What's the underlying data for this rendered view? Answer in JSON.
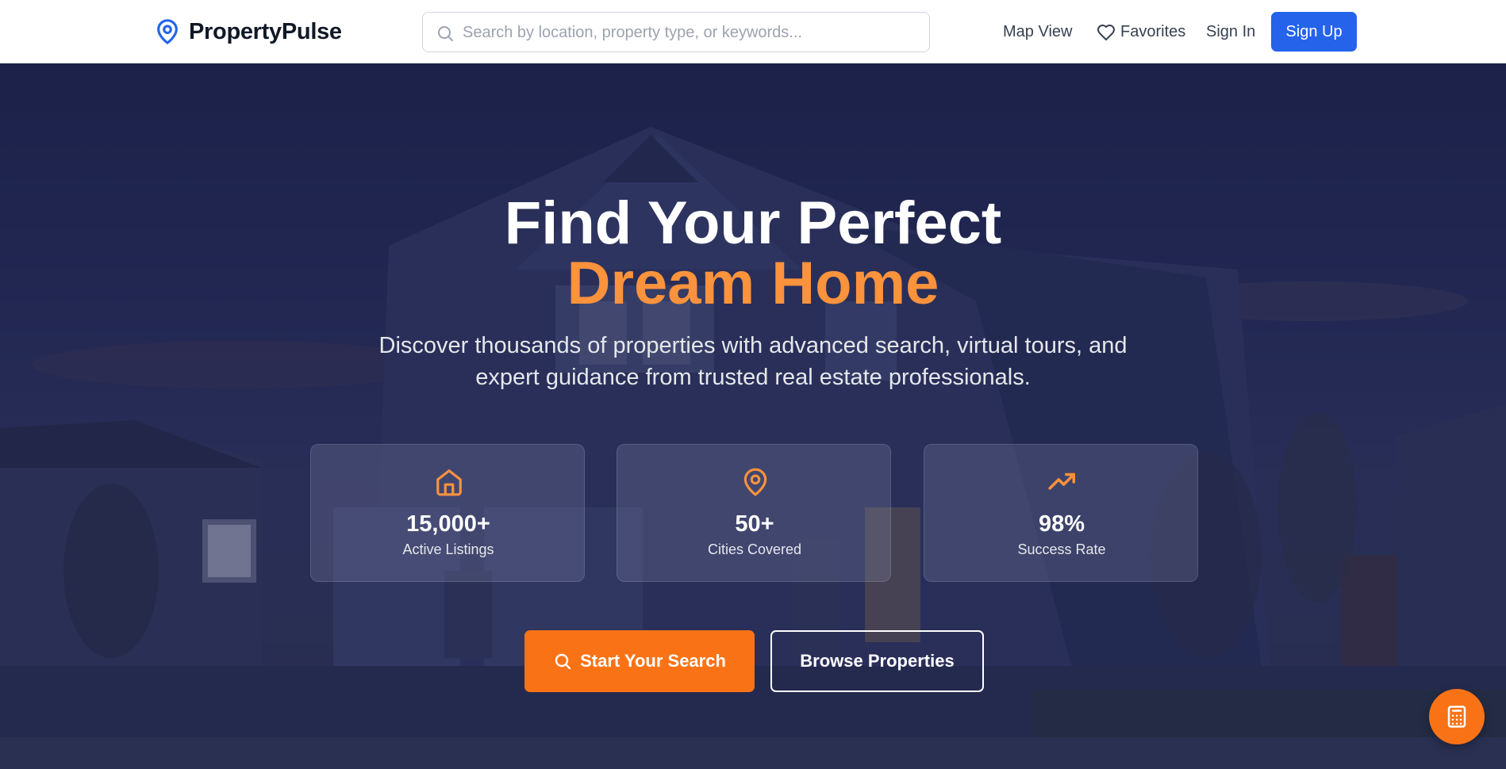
{
  "header": {
    "brand": "PropertyPulse",
    "search_placeholder": "Search by location, property type, or keywords...",
    "nav": {
      "map_view": "Map View",
      "favorites": "Favorites",
      "sign_in": "Sign In",
      "sign_up": "Sign Up"
    }
  },
  "hero": {
    "title_line1": "Find Your Perfect",
    "title_line2": "Dream Home",
    "subtitle": "Discover thousands of properties with advanced search, virtual tours, and expert guidance from trusted real estate professionals.",
    "stats": [
      {
        "icon": "home-icon",
        "value": "15,000+",
        "label": "Active Listings"
      },
      {
        "icon": "map-pin-icon",
        "value": "50+",
        "label": "Cities Covered"
      },
      {
        "icon": "trending-up-icon",
        "value": "98%",
        "label": "Success Rate"
      }
    ],
    "buttons": {
      "start_search": "Start Your Search",
      "browse": "Browse Properties"
    }
  },
  "colors": {
    "brand_blue": "#2563eb",
    "accent_orange": "#f97316",
    "title_orange": "#fb923c"
  },
  "floating_action": {
    "icon": "calculator-icon"
  }
}
